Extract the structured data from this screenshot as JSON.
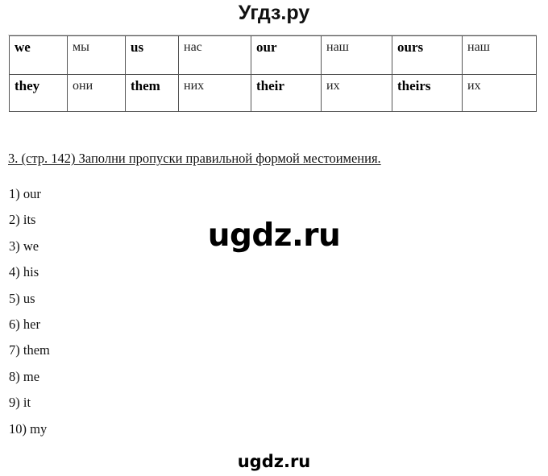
{
  "site_title": "Угдз.ру",
  "pronoun_table": {
    "rows": [
      [
        {
          "text": "we",
          "lang": "en"
        },
        {
          "text": "мы",
          "lang": "ru"
        },
        {
          "text": "us",
          "lang": "en"
        },
        {
          "text": "нас",
          "lang": "ru"
        },
        {
          "text": "our",
          "lang": "en"
        },
        {
          "text": "наш",
          "lang": "ru"
        },
        {
          "text": "ours",
          "lang": "en"
        },
        {
          "text": "наш",
          "lang": "ru"
        }
      ],
      [
        {
          "text": "they",
          "lang": "en"
        },
        {
          "text": "они",
          "lang": "ru"
        },
        {
          "text": "them",
          "lang": "en"
        },
        {
          "text": "них",
          "lang": "ru"
        },
        {
          "text": "their",
          "lang": "en"
        },
        {
          "text": "их",
          "lang": "ru"
        },
        {
          "text": "theirs",
          "lang": "en"
        },
        {
          "text": "их",
          "lang": "ru"
        }
      ]
    ]
  },
  "task": {
    "heading": "3. (стр. 142) Заполни пропуски правильной формой местоимения.",
    "answers": [
      "1) our",
      "2) its",
      "3) we",
      "4) his",
      "5) us",
      "6) her",
      "7) them",
      "8) me",
      "9) it",
      "10) my"
    ]
  },
  "watermarks": {
    "center": "ugdz.ru",
    "bottom": "ugdz.ru"
  }
}
